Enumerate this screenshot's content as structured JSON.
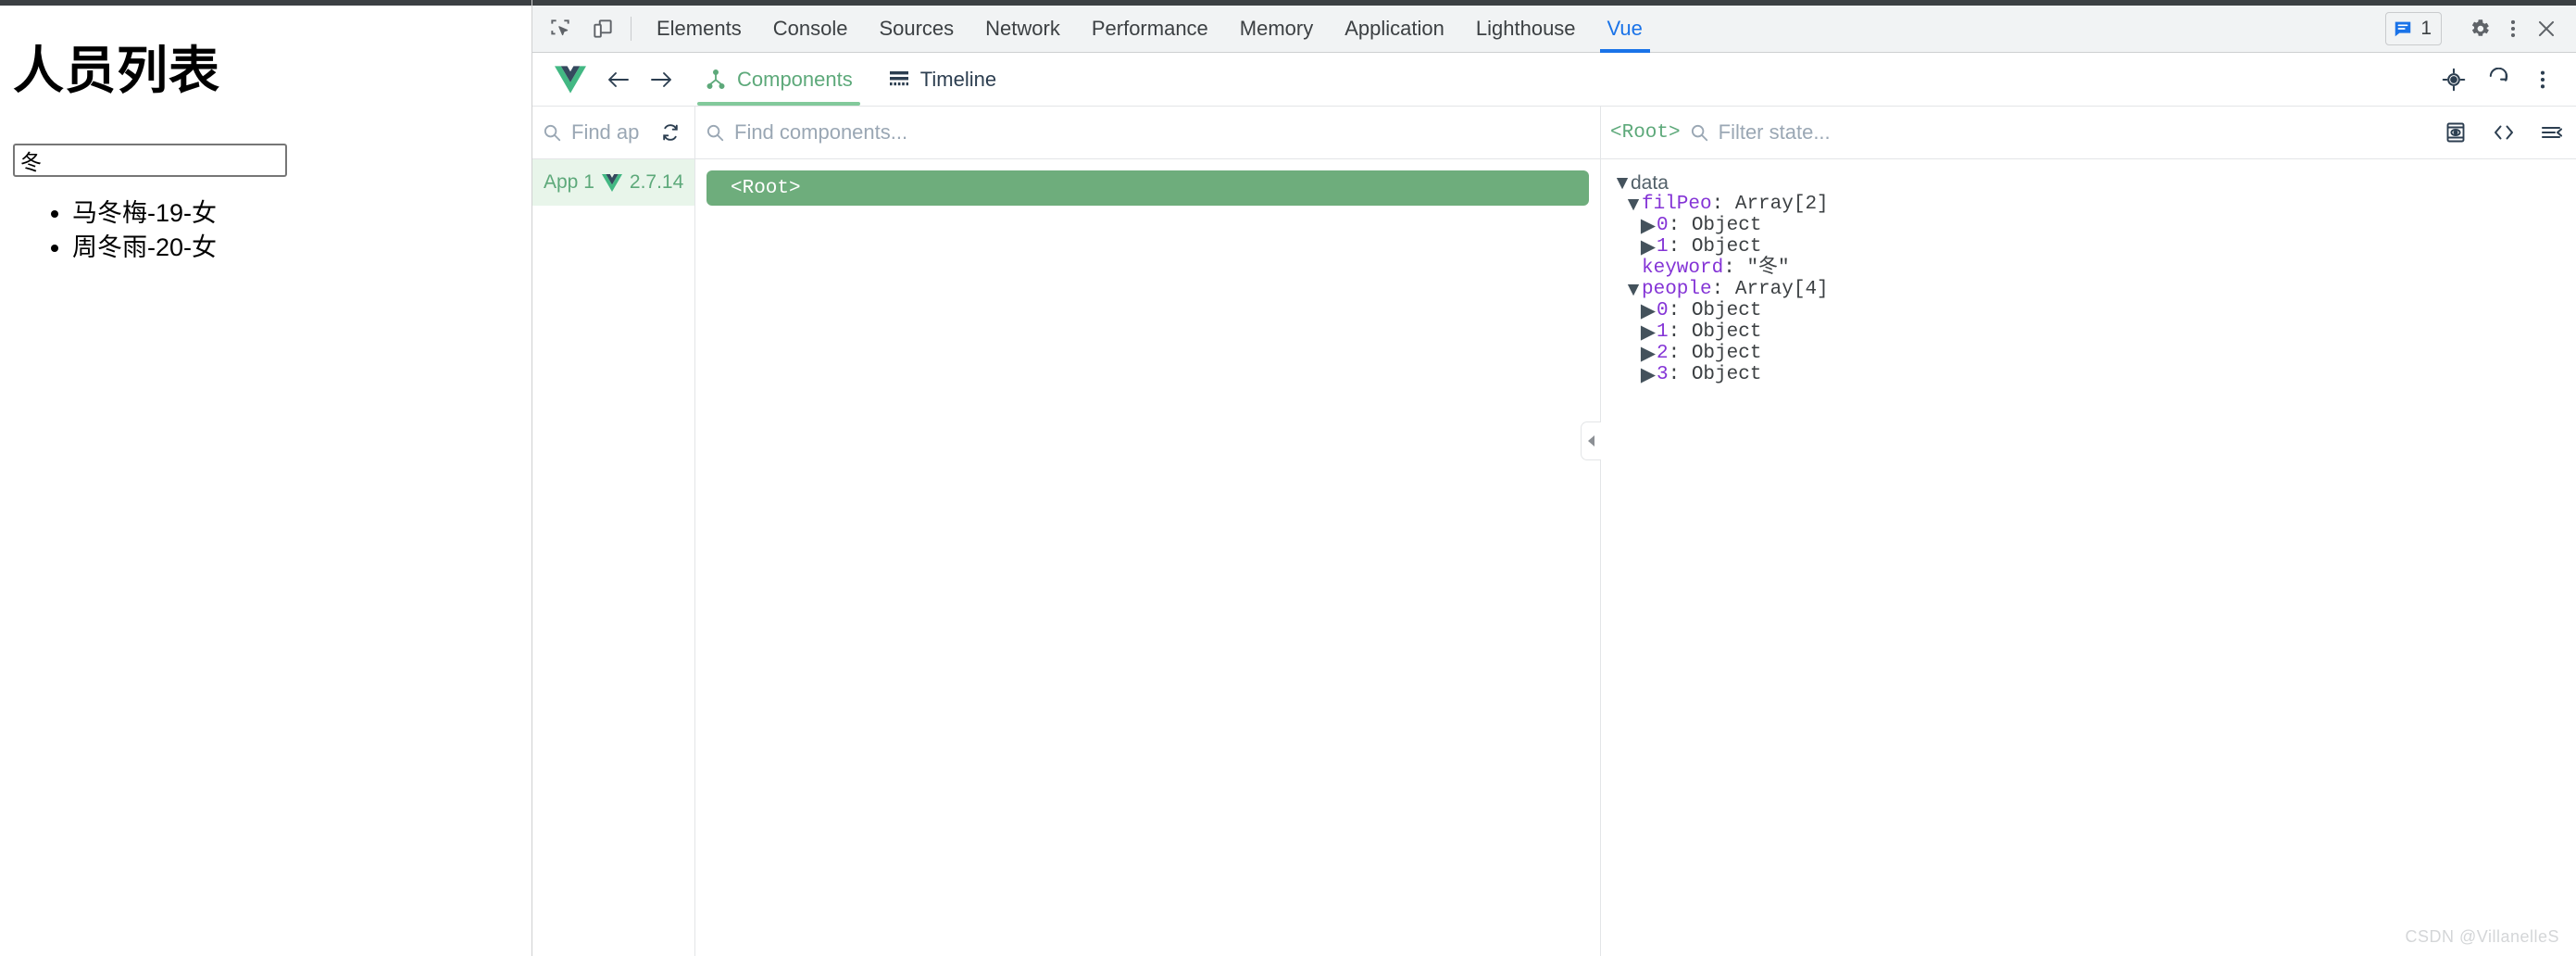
{
  "page": {
    "title": "人员列表",
    "search_value": "冬",
    "search_placeholder": "",
    "list": [
      "马冬梅-19-女",
      "周冬雨-20-女"
    ]
  },
  "devtools": {
    "left_icons": [
      {
        "name": "inspect-element-icon",
        "label": "Inspect element"
      },
      {
        "name": "device-toolbar-icon",
        "label": "Toggle device toolbar"
      }
    ],
    "tabs": [
      {
        "label": "Elements",
        "active": false
      },
      {
        "label": "Console",
        "active": false
      },
      {
        "label": "Sources",
        "active": false
      },
      {
        "label": "Network",
        "active": false
      },
      {
        "label": "Performance",
        "active": false
      },
      {
        "label": "Memory",
        "active": false
      },
      {
        "label": "Application",
        "active": false
      },
      {
        "label": "Lighthouse",
        "active": false
      },
      {
        "label": "Vue",
        "active": true
      }
    ],
    "message_count": "1",
    "right_icons": [
      {
        "name": "settings-gear-icon"
      },
      {
        "name": "more-options-icon"
      },
      {
        "name": "close-icon"
      }
    ],
    "accent_color": "#1a73e8"
  },
  "vue_panel": {
    "back_label": "Back",
    "forward_label": "Forward",
    "tabs": [
      {
        "label": "Components",
        "active": true
      },
      {
        "label": "Timeline",
        "active": false
      }
    ],
    "toolbar_icons": [
      {
        "name": "select-component-icon"
      },
      {
        "name": "refresh-icon"
      },
      {
        "name": "more-options-icon"
      }
    ],
    "accent_color": "#5da97a",
    "apps": {
      "search_placeholder": "Find ap",
      "refresh_label": "Refresh",
      "items": [
        {
          "name": "App 1",
          "version": "2.7.14"
        }
      ]
    },
    "components": {
      "search_placeholder": "Find components...",
      "tree": [
        {
          "label": "<Root>",
          "selected": true
        }
      ]
    },
    "state": {
      "breadcrumb": "<Root>",
      "filter_placeholder": "Filter state...",
      "icons": [
        {
          "name": "inspect-dom-icon"
        },
        {
          "name": "open-in-editor-icon"
        },
        {
          "name": "collapse-all-icon"
        }
      ],
      "sections": [
        {
          "name": "data",
          "expanded": true,
          "entries": [
            {
              "key": "filPeo",
              "value": "Array[2]",
              "expanded": true,
              "children": [
                {
                  "key": "0",
                  "value": "Object",
                  "expanded": false
                },
                {
                  "key": "1",
                  "value": "Object",
                  "expanded": false
                }
              ]
            },
            {
              "key": "keyword",
              "value": "\"冬\"",
              "expanded": null,
              "children": []
            },
            {
              "key": "people",
              "value": "Array[4]",
              "expanded": true,
              "children": [
                {
                  "key": "0",
                  "value": "Object",
                  "expanded": false
                },
                {
                  "key": "1",
                  "value": "Object",
                  "expanded": false
                },
                {
                  "key": "2",
                  "value": "Object",
                  "expanded": false
                },
                {
                  "key": "3",
                  "value": "Object",
                  "expanded": false
                }
              ]
            }
          ]
        }
      ]
    }
  },
  "watermark": "CSDN @VillanelleS"
}
